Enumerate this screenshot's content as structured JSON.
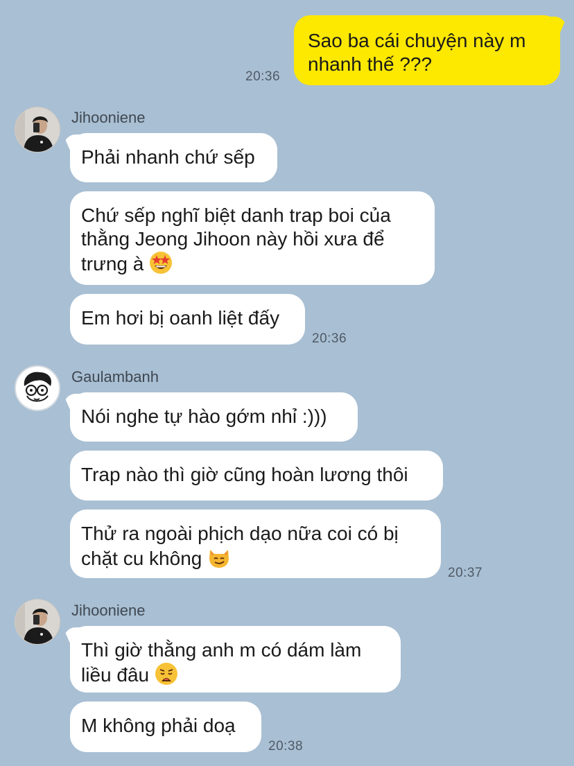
{
  "messages": {
    "m0": {
      "text_line1": "Sao ba cái chuyện này m",
      "text_line2": "nhanh thế ???",
      "time": "20:36"
    },
    "g1": {
      "sender": "Jihooniene",
      "b1": "Phải nhanh chứ sếp",
      "b2_line1": "Chứ sếp nghĩ biệt danh trap boi của",
      "b2_line2": "thằng Jeong Jihoon này hồi xưa để",
      "b2_line3": "trưng à",
      "b3": "Em hơi bị oanh liệt đấy",
      "time": "20:36"
    },
    "g2": {
      "sender": "Gaulambanh",
      "b1": "Nói nghe tự hào gớm nhỉ :)))",
      "b2": "Trap nào thì giờ cũng hoàn lương thôi",
      "b3_line1": "Thử ra ngoài phịch dạo nữa coi có bị",
      "b3_line2": "chặt cu không",
      "time": "20:37"
    },
    "g3": {
      "sender": "Jihooniene",
      "b1_line1": "Thì giờ thằng anh m có dám làm",
      "b1_line2": "liều đâu",
      "b2": "M không phải doạ",
      "time": "20:38"
    }
  },
  "icons": {
    "star_struck": "star-struck-emoji",
    "smirk_cat": "smirking-cat-emoji",
    "weary": "weary-face-emoji"
  },
  "colors": {
    "background": "#a9bfd3",
    "my_bubble": "#fde800",
    "their_bubble": "#ffffff",
    "time_text": "#4f5a66"
  }
}
